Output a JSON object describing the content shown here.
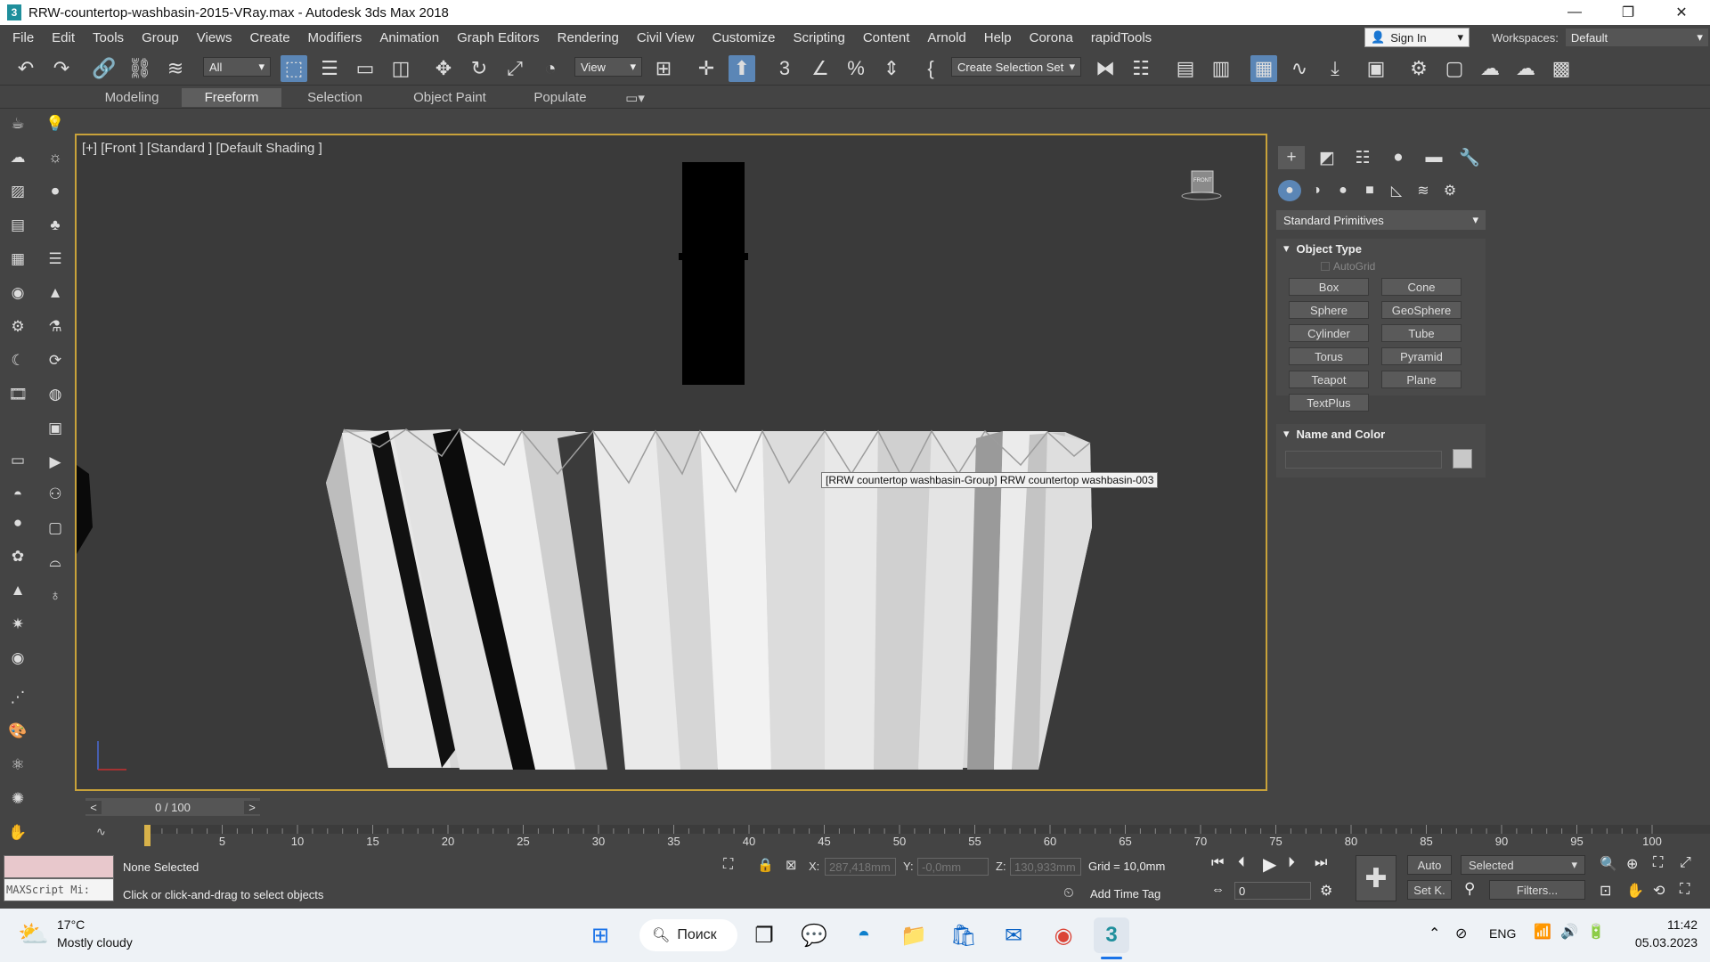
{
  "window": {
    "title": "RRW-countertop-washbasin-2015-VRay.max - Autodesk 3ds Max 2018",
    "app_icon": "3",
    "minimize": "—",
    "maximize": "❐",
    "close": "✕"
  },
  "menu": [
    "File",
    "Edit",
    "Tools",
    "Group",
    "Views",
    "Create",
    "Modifiers",
    "Animation",
    "Graph Editors",
    "Rendering",
    "Civil View",
    "Customize",
    "Scripting",
    "Content",
    "Arnold",
    "Help",
    "Corona",
    "rapidTools"
  ],
  "signin": {
    "label": "Sign In"
  },
  "workspaces": {
    "label": "Workspaces:",
    "value": "Default"
  },
  "toolbar": {
    "filter_value": "All",
    "refcoord_value": "View",
    "selection_set_value": "Create Selection Set"
  },
  "ribbon": {
    "tabs": [
      "Modeling",
      "Freeform",
      "Selection",
      "Object Paint",
      "Populate"
    ],
    "active": "Freeform"
  },
  "viewport": {
    "label": "[+] [Front ] [Standard ] [Default Shading ]",
    "tooltip": "[RRW countertop washbasin-Group] RRW countertop washbasin-003",
    "viewcube_label": "FRONT"
  },
  "command_panel": {
    "category": "Standard Primitives",
    "object_type": {
      "title": "Object Type",
      "autogrid": "AutoGrid",
      "buttons": [
        "Box",
        "Cone",
        "Sphere",
        "GeoSphere",
        "Cylinder",
        "Tube",
        "Torus",
        "Pyramid",
        "Teapot",
        "Plane",
        "TextPlus"
      ]
    },
    "name_color": {
      "title": "Name and Color",
      "name_value": "",
      "swatch_color": "#c8c8c8"
    }
  },
  "timeline": {
    "slider_text": "0 / 100",
    "prev": "<",
    "next": ">",
    "ticks": [
      "5",
      "10",
      "15",
      "20",
      "25",
      "30",
      "35",
      "40",
      "45",
      "50",
      "55",
      "60",
      "65",
      "70",
      "75",
      "80",
      "85",
      "90",
      "95",
      "100"
    ]
  },
  "status": {
    "maxscript": "MAXScript Mi:",
    "selection": "None Selected",
    "prompt": "Click or click-and-drag to select objects",
    "x_label": "X:",
    "x_value": "287,418mm",
    "y_label": "Y:",
    "y_value": "-0,0mm",
    "z_label": "Z:",
    "z_value": "130,933mm",
    "grid": "Grid = 10,0mm",
    "add_time_tag": "Add Time Tag",
    "auto": "Auto",
    "setk": "Set K.",
    "key_filter": "Selected",
    "filters": "Filters...",
    "frame_value": "0"
  },
  "taskbar": {
    "weather_temp": "17°C",
    "weather_desc": "Mostly cloudy",
    "search_label": "Поиск",
    "lang": "ENG",
    "time": "11:42",
    "date": "05.03.2023"
  },
  "colors": {
    "accent": "#5b86b6",
    "viewport_border": "#c8a23a"
  }
}
